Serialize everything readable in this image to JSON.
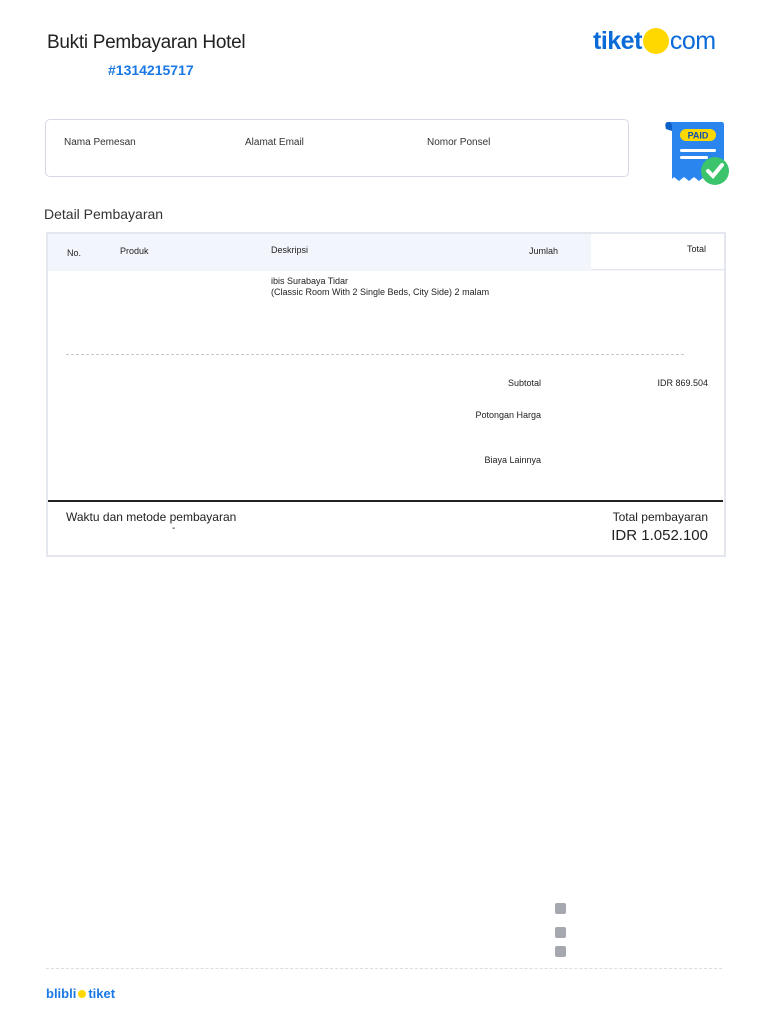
{
  "header": {
    "title": "Bukti Pembayaran Hotel",
    "order_id": "#1314215717",
    "logo": "tiket.com",
    "logo_left": "tiket",
    "logo_right": "com"
  },
  "customer": {
    "name_label": "Nama Pemesan",
    "email_label": "Alamat Email",
    "phone_label": "Nomor Ponsel"
  },
  "badge": {
    "text": "PAID",
    "icon": "paid-receipt-icon"
  },
  "detail": {
    "title": "Detail Pembayaran",
    "columns": [
      "No.",
      "Produk",
      "Deskripsi",
      "Jumlah",
      "Total"
    ],
    "item": {
      "hotel": "ibis Surabaya Tidar",
      "room": "(Classic Room With 2 Single Beds, City Side) 2 malam"
    },
    "subtotal_label": "Subtotal",
    "subtotal_value": "IDR 869.504",
    "discount_label": "Potongan Harga",
    "other_label": "Biaya Lainnya",
    "payment_method_label": "Waktu dan metode pembayaran",
    "payment_method_value": "-",
    "total_label": "Total pembayaran",
    "total_value": "IDR 1.052.100"
  },
  "footer": {
    "logo": "blibli tiket",
    "logo_left": "blibli",
    "logo_right": "tiket",
    "icons": [
      "phone-icon",
      "email-icon",
      "location-icon"
    ]
  },
  "colors": {
    "brand_blue": "#0a6ad8",
    "brand_yellow": "#ffd800",
    "paid_green": "#3cc46c"
  }
}
